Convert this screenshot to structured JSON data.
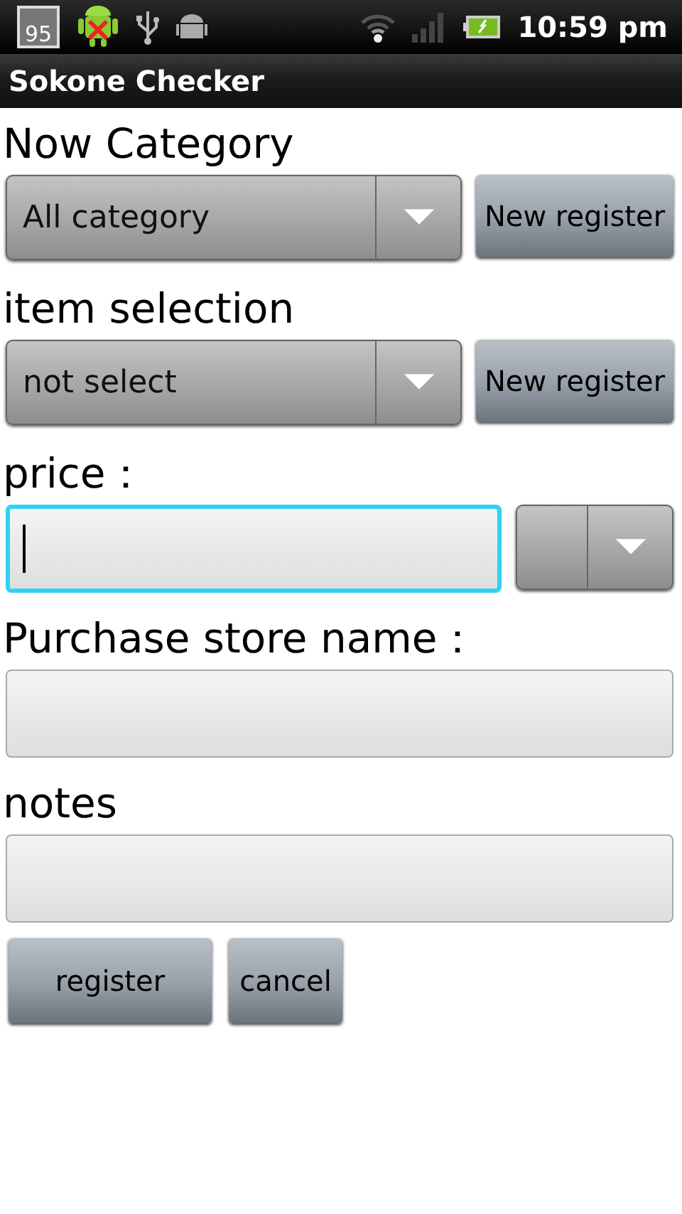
{
  "status_bar": {
    "notification_count": "95",
    "time": "10:59 pm"
  },
  "title": "Sokone Checker",
  "sections": [
    {
      "kind": "select",
      "label": "Now Category",
      "value": "All category",
      "button": "New register"
    },
    {
      "kind": "select",
      "label": "item selection",
      "value": "not select",
      "button": "New register"
    },
    {
      "kind": "text_with_unit",
      "label": "price：",
      "focused": true
    },
    {
      "kind": "text",
      "label": "Purchase store name：",
      "focused": false
    },
    {
      "kind": "text",
      "label": "notes",
      "focused": false
    }
  ],
  "buttons": [
    "register",
    "cancel"
  ]
}
